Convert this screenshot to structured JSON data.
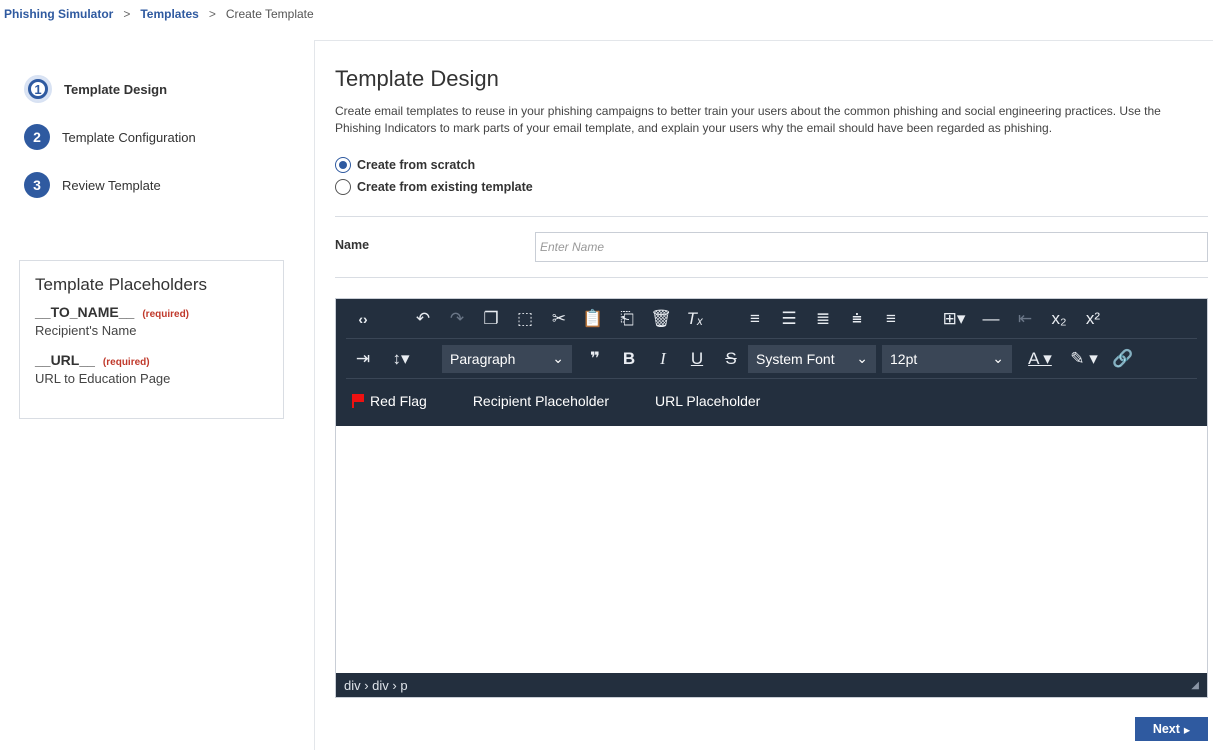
{
  "breadcrumb": {
    "item1": "Phishing Simulator",
    "sep1": ">",
    "item2": "Templates",
    "sep2": ">",
    "current": "Create Template"
  },
  "steps": [
    {
      "num": "1",
      "label": "Template Design"
    },
    {
      "num": "2",
      "label": "Template Configuration"
    },
    {
      "num": "3",
      "label": "Review Template"
    }
  ],
  "placeholders": {
    "title": "Template Placeholders",
    "items": [
      {
        "key": "__TO_NAME__",
        "required": "(required)",
        "desc": "Recipient's Name"
      },
      {
        "key": "__URL__",
        "required": "(required)",
        "desc": "URL to Education Page"
      }
    ]
  },
  "main": {
    "title": "Template Design",
    "description": "Create email templates to reuse in your phishing campaigns to better train your users about the common phishing and social engineering practices. Use the Phishing Indicators to mark parts of your email template, and explain your users why the email should have been regarded as phishing.",
    "radio_scratch": "Create from scratch",
    "radio_existing": "Create from existing template",
    "name_label": "Name",
    "name_placeholder": "Enter Name"
  },
  "editor": {
    "block_format": "Paragraph",
    "font_family": "System Font",
    "font_size": "12pt",
    "custom_red_flag": "Red Flag",
    "custom_recipient": "Recipient Placeholder",
    "custom_url": "URL Placeholder",
    "status_path": "div › div › p"
  },
  "next_label": "Next"
}
